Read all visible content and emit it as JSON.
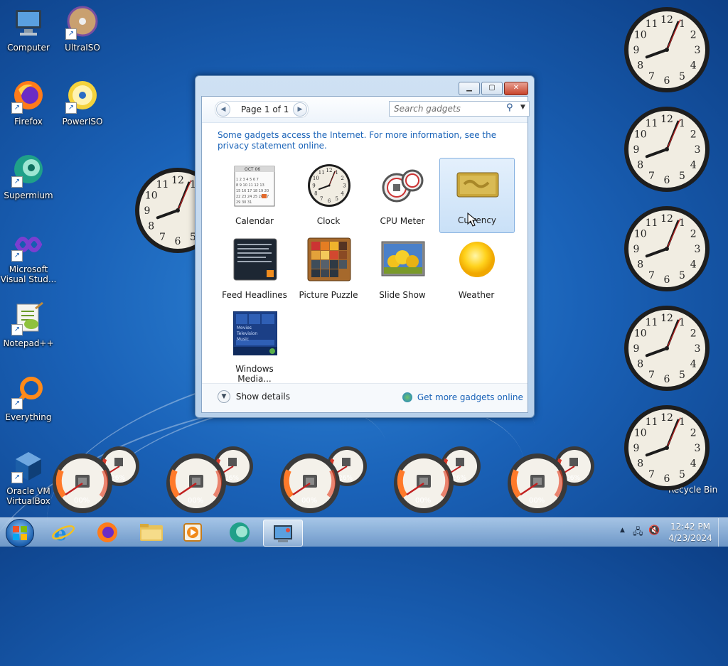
{
  "desktop": {
    "icons": [
      {
        "label": "Computer"
      },
      {
        "label": "UltraISO"
      },
      {
        "label": "Firefox"
      },
      {
        "label": "PowerISO"
      },
      {
        "label": "Supermium"
      },
      {
        "label": "Microsoft Visual Stud..."
      },
      {
        "label": "Notepad++"
      },
      {
        "label": "Everything"
      },
      {
        "label": "Oracle VM VirtualBox"
      },
      {
        "label": "Recycle Bin"
      }
    ],
    "cpu_meters": [
      {
        "cpu": "00%",
        "mem": "26%"
      },
      {
        "cpu": "00%",
        "mem": "26%"
      },
      {
        "cpu": "00%",
        "mem": "26%"
      },
      {
        "cpu": "00%",
        "mem": "26%"
      },
      {
        "cpu": "00%",
        "mem": "26%"
      }
    ]
  },
  "gadget_window": {
    "page_label": "Page 1 of 1",
    "search_placeholder": "Search gadgets",
    "info_text": "Some gadgets access the Internet.  For more information, see the privacy statement online.",
    "gadgets": [
      {
        "label": "Calendar",
        "icon": "calendar-icon"
      },
      {
        "label": "Clock",
        "icon": "clock-icon"
      },
      {
        "label": "CPU Meter",
        "icon": "cpu-meter-icon"
      },
      {
        "label": "Currency",
        "icon": "currency-icon",
        "selected": true
      },
      {
        "label": "Feed Headlines",
        "icon": "feed-icon"
      },
      {
        "label": "Picture Puzzle",
        "icon": "puzzle-icon"
      },
      {
        "label": "Slide Show",
        "icon": "slideshow-icon"
      },
      {
        "label": "Weather",
        "icon": "weather-icon"
      },
      {
        "label": "Windows Media...",
        "icon": "media-center-icon"
      }
    ],
    "calendar_month": "OCT 06",
    "media_items": [
      "Movies",
      "Television",
      "Music"
    ],
    "show_details": "Show details",
    "get_more": "Get more gadgets online"
  },
  "taskbar": {
    "time": "12:42 PM",
    "date": "4/23/2024"
  }
}
